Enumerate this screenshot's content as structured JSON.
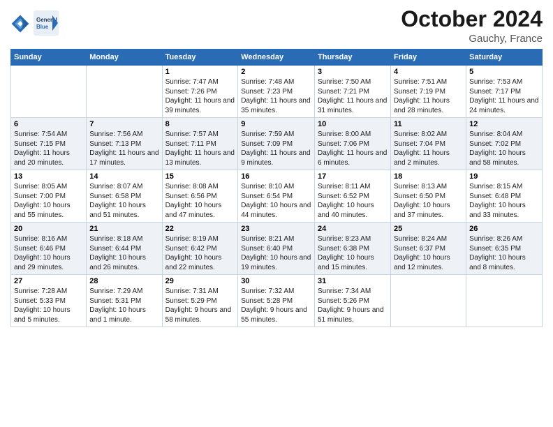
{
  "header": {
    "logo_line1": "General",
    "logo_line2": "Blue",
    "month": "October 2024",
    "location": "Gauchy, France"
  },
  "weekdays": [
    "Sunday",
    "Monday",
    "Tuesday",
    "Wednesday",
    "Thursday",
    "Friday",
    "Saturday"
  ],
  "weeks": [
    [
      {
        "day": "",
        "info": ""
      },
      {
        "day": "",
        "info": ""
      },
      {
        "day": "1",
        "info": "Sunrise: 7:47 AM\nSunset: 7:26 PM\nDaylight: 11 hours and 39 minutes."
      },
      {
        "day": "2",
        "info": "Sunrise: 7:48 AM\nSunset: 7:23 PM\nDaylight: 11 hours and 35 minutes."
      },
      {
        "day": "3",
        "info": "Sunrise: 7:50 AM\nSunset: 7:21 PM\nDaylight: 11 hours and 31 minutes."
      },
      {
        "day": "4",
        "info": "Sunrise: 7:51 AM\nSunset: 7:19 PM\nDaylight: 11 hours and 28 minutes."
      },
      {
        "day": "5",
        "info": "Sunrise: 7:53 AM\nSunset: 7:17 PM\nDaylight: 11 hours and 24 minutes."
      }
    ],
    [
      {
        "day": "6",
        "info": "Sunrise: 7:54 AM\nSunset: 7:15 PM\nDaylight: 11 hours and 20 minutes."
      },
      {
        "day": "7",
        "info": "Sunrise: 7:56 AM\nSunset: 7:13 PM\nDaylight: 11 hours and 17 minutes."
      },
      {
        "day": "8",
        "info": "Sunrise: 7:57 AM\nSunset: 7:11 PM\nDaylight: 11 hours and 13 minutes."
      },
      {
        "day": "9",
        "info": "Sunrise: 7:59 AM\nSunset: 7:09 PM\nDaylight: 11 hours and 9 minutes."
      },
      {
        "day": "10",
        "info": "Sunrise: 8:00 AM\nSunset: 7:06 PM\nDaylight: 11 hours and 6 minutes."
      },
      {
        "day": "11",
        "info": "Sunrise: 8:02 AM\nSunset: 7:04 PM\nDaylight: 11 hours and 2 minutes."
      },
      {
        "day": "12",
        "info": "Sunrise: 8:04 AM\nSunset: 7:02 PM\nDaylight: 10 hours and 58 minutes."
      }
    ],
    [
      {
        "day": "13",
        "info": "Sunrise: 8:05 AM\nSunset: 7:00 PM\nDaylight: 10 hours and 55 minutes."
      },
      {
        "day": "14",
        "info": "Sunrise: 8:07 AM\nSunset: 6:58 PM\nDaylight: 10 hours and 51 minutes."
      },
      {
        "day": "15",
        "info": "Sunrise: 8:08 AM\nSunset: 6:56 PM\nDaylight: 10 hours and 47 minutes."
      },
      {
        "day": "16",
        "info": "Sunrise: 8:10 AM\nSunset: 6:54 PM\nDaylight: 10 hours and 44 minutes."
      },
      {
        "day": "17",
        "info": "Sunrise: 8:11 AM\nSunset: 6:52 PM\nDaylight: 10 hours and 40 minutes."
      },
      {
        "day": "18",
        "info": "Sunrise: 8:13 AM\nSunset: 6:50 PM\nDaylight: 10 hours and 37 minutes."
      },
      {
        "day": "19",
        "info": "Sunrise: 8:15 AM\nSunset: 6:48 PM\nDaylight: 10 hours and 33 minutes."
      }
    ],
    [
      {
        "day": "20",
        "info": "Sunrise: 8:16 AM\nSunset: 6:46 PM\nDaylight: 10 hours and 29 minutes."
      },
      {
        "day": "21",
        "info": "Sunrise: 8:18 AM\nSunset: 6:44 PM\nDaylight: 10 hours and 26 minutes."
      },
      {
        "day": "22",
        "info": "Sunrise: 8:19 AM\nSunset: 6:42 PM\nDaylight: 10 hours and 22 minutes."
      },
      {
        "day": "23",
        "info": "Sunrise: 8:21 AM\nSunset: 6:40 PM\nDaylight: 10 hours and 19 minutes."
      },
      {
        "day": "24",
        "info": "Sunrise: 8:23 AM\nSunset: 6:38 PM\nDaylight: 10 hours and 15 minutes."
      },
      {
        "day": "25",
        "info": "Sunrise: 8:24 AM\nSunset: 6:37 PM\nDaylight: 10 hours and 12 minutes."
      },
      {
        "day": "26",
        "info": "Sunrise: 8:26 AM\nSunset: 6:35 PM\nDaylight: 10 hours and 8 minutes."
      }
    ],
    [
      {
        "day": "27",
        "info": "Sunrise: 7:28 AM\nSunset: 5:33 PM\nDaylight: 10 hours and 5 minutes."
      },
      {
        "day": "28",
        "info": "Sunrise: 7:29 AM\nSunset: 5:31 PM\nDaylight: 10 hours and 1 minute."
      },
      {
        "day": "29",
        "info": "Sunrise: 7:31 AM\nSunset: 5:29 PM\nDaylight: 9 hours and 58 minutes."
      },
      {
        "day": "30",
        "info": "Sunrise: 7:32 AM\nSunset: 5:28 PM\nDaylight: 9 hours and 55 minutes."
      },
      {
        "day": "31",
        "info": "Sunrise: 7:34 AM\nSunset: 5:26 PM\nDaylight: 9 hours and 51 minutes."
      },
      {
        "day": "",
        "info": ""
      },
      {
        "day": "",
        "info": ""
      }
    ]
  ]
}
